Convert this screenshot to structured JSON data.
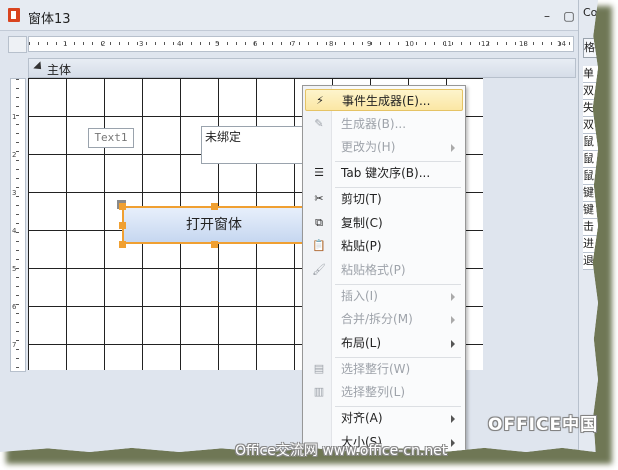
{
  "window": {
    "title": "窗体13",
    "close_glyph": "×",
    "restore_glyph": "▢",
    "minimize_glyph": "–"
  },
  "ruler": {
    "marks": [
      "1",
      "2",
      "3",
      "4",
      "5",
      "6",
      "7",
      "8",
      "9",
      "10",
      "11",
      "12",
      "13",
      "14",
      "15"
    ],
    "v_marks": [
      "1",
      "2",
      "3",
      "4",
      "5",
      "6",
      "7"
    ]
  },
  "section": {
    "label": "主体"
  },
  "form": {
    "textbox_label": "Text1",
    "unbound_text": "未绑定",
    "button_label": "打开窗体"
  },
  "properties_panel": {
    "header": "Co",
    "tab": "格式",
    "rows": [
      "单",
      "双",
      "失",
      "双",
      "鼠",
      "鼠",
      "鼠",
      "键",
      "键",
      "击",
      "进",
      "退"
    ]
  },
  "context_menu": {
    "items": [
      {
        "label": "事件生成器(E)...",
        "icon": "⚡",
        "icon_name": "event-builder-icon",
        "enabled": true,
        "highlighted": true,
        "submenu": false
      },
      {
        "label": "生成器(B)...",
        "icon": "✎",
        "icon_name": "builder-icon",
        "enabled": false,
        "submenu": false
      },
      {
        "label": "更改为(H)",
        "icon": "",
        "icon_name": "",
        "enabled": false,
        "submenu": true
      },
      {
        "label": "Tab 键次序(B)...",
        "icon": "☰",
        "icon_name": "tab-order-icon",
        "enabled": true,
        "submenu": false,
        "sep_before": true
      },
      {
        "label": "剪切(T)",
        "icon": "✂",
        "icon_name": "cut-icon",
        "enabled": true,
        "submenu": false,
        "sep_before": true
      },
      {
        "label": "复制(C)",
        "icon": "⧉",
        "icon_name": "copy-icon",
        "enabled": true,
        "submenu": false
      },
      {
        "label": "粘贴(P)",
        "icon": "📋",
        "icon_name": "paste-icon",
        "enabled": true,
        "submenu": false
      },
      {
        "label": "粘贴格式(P)",
        "icon": "🖌",
        "icon_name": "paste-format-icon",
        "enabled": false,
        "submenu": false
      },
      {
        "label": "插入(I)",
        "icon": "",
        "icon_name": "",
        "enabled": false,
        "submenu": true,
        "sep_before": true
      },
      {
        "label": "合并/拆分(M)",
        "icon": "",
        "icon_name": "",
        "enabled": false,
        "submenu": true
      },
      {
        "label": "布局(L)",
        "icon": "",
        "icon_name": "",
        "enabled": true,
        "submenu": true
      },
      {
        "label": "选择整行(W)",
        "icon": "▤",
        "icon_name": "select-row-icon",
        "enabled": false,
        "submenu": false,
        "sep_before": true
      },
      {
        "label": "选择整列(L)",
        "icon": "▥",
        "icon_name": "select-column-icon",
        "enabled": false,
        "submenu": false
      },
      {
        "label": "对齐(A)",
        "icon": "",
        "icon_name": "",
        "enabled": true,
        "submenu": true,
        "sep_before": true
      },
      {
        "label": "大小(S)",
        "icon": "",
        "icon_name": "",
        "enabled": true,
        "submenu": true
      }
    ]
  },
  "watermarks": {
    "brand": "OFFICE中国",
    "site": "Office交流网 www.office-cn.net"
  },
  "colors": {
    "highlight": "#fbe7a4",
    "selection_border": "#f0a032",
    "button_fill": "#c6d7f0",
    "disabled_text": "#9ea3aa"
  }
}
